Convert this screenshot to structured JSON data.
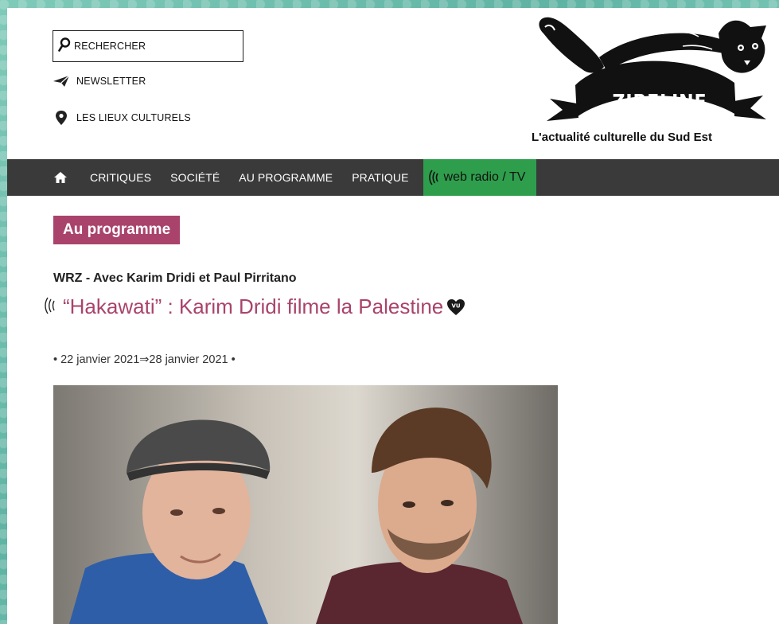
{
  "header": {
    "search_label": "RECHERCHER",
    "newsletter_label": "NEWSLETTER",
    "places_label": "LES LIEUX CULTURELS",
    "logo_text": "ZIBELINE",
    "tagline": "L'actualité culturelle du Sud Est"
  },
  "nav": {
    "items": [
      "CRITIQUES",
      "SOCIÉTÉ",
      "AU PROGRAMME",
      "PRATIQUE"
    ],
    "radio_label": "web radio / TV"
  },
  "article": {
    "rubrique": "Au programme",
    "surtitle": "WRZ - Avec Karim Dridi et Paul Pirritano",
    "title": "“Hakawati” : Karim Dridi filme la Palestine",
    "dates": "• 22 janvier 2021⇒28 janvier 2021 •"
  },
  "colors": {
    "accent": "#a9436b",
    "nav_bg": "#3a3a3a",
    "radio_green": "#2e9e4c"
  },
  "icons": {
    "search": "search-icon",
    "newsletter": "paper-plane-icon",
    "places": "map-pin-icon",
    "home": "home-icon",
    "radio": "radio-waves-icon",
    "vu": "heart-vu-icon"
  }
}
